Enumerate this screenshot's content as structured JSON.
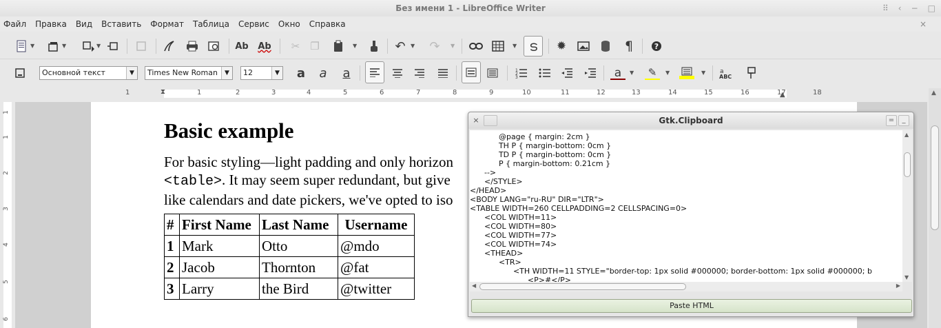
{
  "window": {
    "title": "Без имени 1 - LibreOffice Writer",
    "controls": [
      "⠿",
      "‹",
      "−",
      "□"
    ]
  },
  "menu": [
    "Файл",
    "Правка",
    "Вид",
    "Вставить",
    "Формат",
    "Таблица",
    "Сервис",
    "Окно",
    "Справка"
  ],
  "menu_close": "×",
  "toolbar1": {
    "icons": [
      "new-document",
      "templates",
      "open",
      "save",
      "export",
      "pdf",
      "print",
      "print-preview",
      "spellcheck",
      "autospellcheck",
      "cut",
      "copy",
      "paste",
      "clone-formatting",
      "undo",
      "redo",
      "hyperlink",
      "table",
      "draw-functions",
      "navigator",
      "image",
      "data-sources",
      "formatting-marks",
      "help"
    ]
  },
  "format": {
    "style": "Основной текст",
    "font": "Times New Roman",
    "size": "12",
    "glyphs": {
      "bold": "a",
      "italic": "a",
      "underline": "a",
      "font_color": "a",
      "highlight": "✎"
    },
    "colors": {
      "font_color": "#8b0000",
      "highlight": "#ffff00",
      "background": "#ffff00"
    }
  },
  "ruler": {
    "marks": [
      "1",
      "1",
      "2",
      "3",
      "4",
      "5",
      "6",
      "7",
      "8",
      "9",
      "10",
      "11",
      "12",
      "13",
      "14",
      "15",
      "16",
      "17",
      "18"
    ]
  },
  "vruler": {
    "marks": [
      "1",
      "1",
      "2",
      "3",
      "4",
      "5",
      "6"
    ]
  },
  "document": {
    "heading": "Basic example",
    "para_line1": "For basic styling—light padding and only horizon",
    "para_code": "<table>",
    "para_line2_rest": ". It may seem super redundant, but give",
    "para_line3": "like calendars and date pickers, we've opted to iso",
    "table": {
      "headers": [
        "#",
        "First Name",
        "Last Name",
        "Username"
      ],
      "rows": [
        [
          "1",
          "Mark",
          "Otto",
          "@mdo"
        ],
        [
          "2",
          "Jacob",
          "Thornton",
          "@fat"
        ],
        [
          "3",
          "Larry",
          "the Bird",
          "@twitter"
        ]
      ]
    }
  },
  "dialog": {
    "title": "Gtk.Clipboard",
    "close": "×",
    "btns": [
      "=",
      "_"
    ],
    "lines": [
      "            @page { margin: 2cm }",
      "            TH P { margin-bottom: 0cm }",
      "            TD P { margin-bottom: 0cm }",
      "            P { margin-bottom: 0.21cm }",
      "      -->",
      "      </STYLE>",
      "</HEAD>",
      "<BODY LANG=\"ru-RU\" DIR=\"LTR\">",
      "<TABLE WIDTH=260 CELLPADDING=2 CELLSPACING=0>",
      "      <COL WIDTH=11>",
      "      <COL WIDTH=80>",
      "      <COL WIDTH=77>",
      "      <COL WIDTH=74>",
      "      <THEAD>",
      "            <TR>",
      "                  <TH WIDTH=11 STYLE=\"border-top: 1px solid #000000; border-bottom: 1px solid #000000; b",
      "                        <P>#</P>"
    ],
    "paste_button": "Paste HTML"
  }
}
